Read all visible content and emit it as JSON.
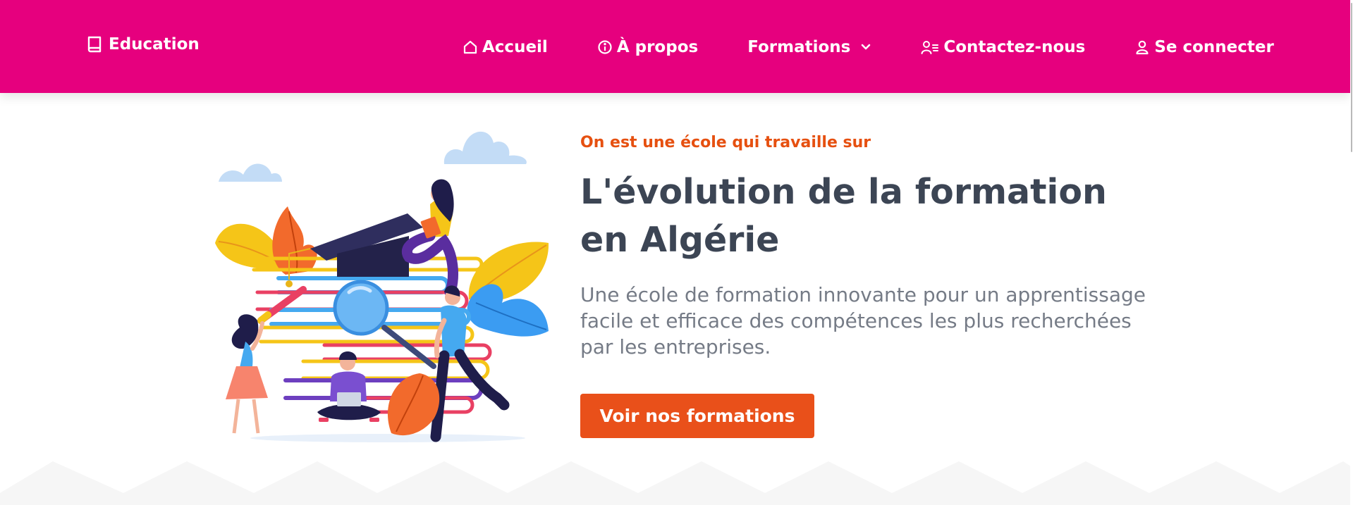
{
  "nav": {
    "brand": {
      "label": "Education",
      "icon": "book-icon"
    },
    "items": [
      {
        "label": "Accueil",
        "icon": "home-icon"
      },
      {
        "label": "À propos",
        "icon": "info-icon"
      },
      {
        "label": "Formations",
        "icon": "chevron-down-icon"
      },
      {
        "label": "Contactez-nous",
        "icon": "contact-list-icon"
      },
      {
        "label": "Se connecter",
        "icon": "user-icon"
      }
    ]
  },
  "hero": {
    "eyebrow": "On est une école qui travaille sur",
    "title": "L'évolution de la formation en Algérie",
    "lead": "Une école de formation innovante pour un apprentissage facile et efficace des compétences les plus recherchées par les entreprises.",
    "cta_label": "Voir nos formations"
  },
  "colors": {
    "navbar_bg": "#e6007e",
    "accent": "#e9501a",
    "eyebrow": "#e65010",
    "heading": "#3c4554",
    "body_text": "#757b86"
  }
}
